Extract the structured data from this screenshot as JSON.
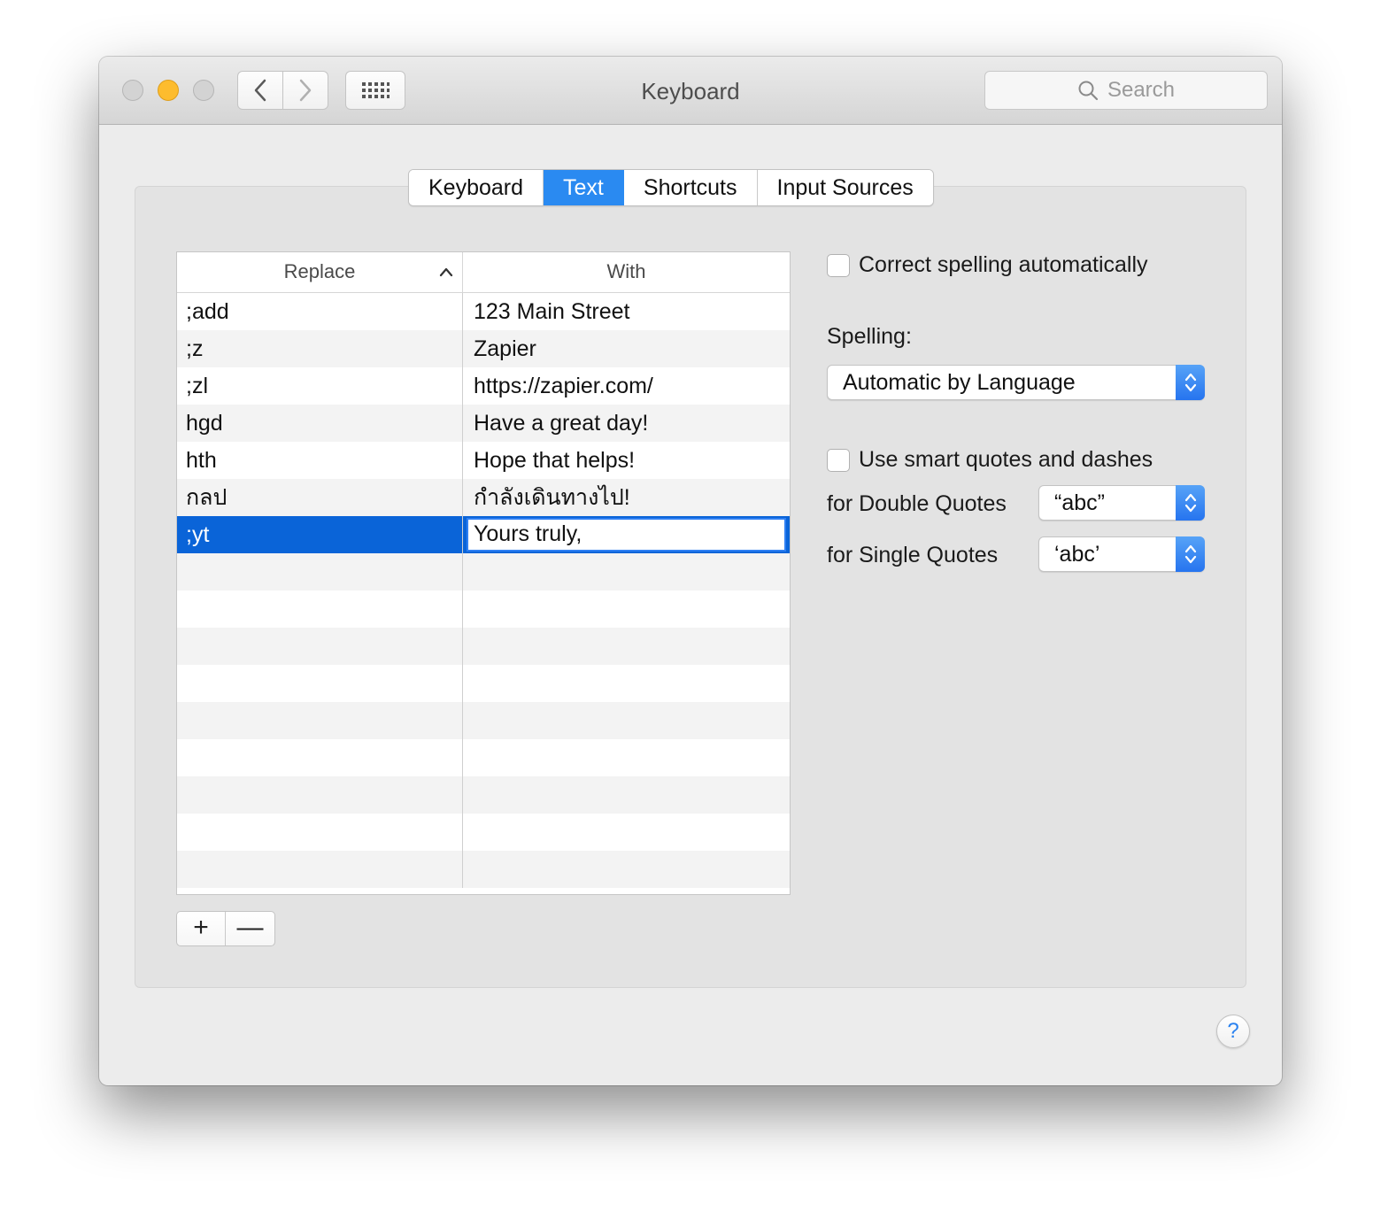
{
  "window": {
    "title": "Keyboard"
  },
  "toolbar": {
    "back_icon": "chevron-left-icon",
    "forward_icon": "chevron-right-icon",
    "grid_icon": "show-all-grid-icon",
    "search_placeholder": "Search"
  },
  "tabs": [
    {
      "label": "Keyboard",
      "active": false
    },
    {
      "label": "Text",
      "active": true
    },
    {
      "label": "Shortcuts",
      "active": false
    },
    {
      "label": "Input Sources",
      "active": false
    }
  ],
  "table": {
    "columns": {
      "replace": "Replace",
      "with": "With",
      "sort": "ascending"
    },
    "rows": [
      {
        "replace": ";add",
        "with": "123 Main Street"
      },
      {
        "replace": ";z",
        "with": "Zapier"
      },
      {
        "replace": ";zl",
        "with": "https://zapier.com/"
      },
      {
        "replace": "hgd",
        "with": "Have a great day!"
      },
      {
        "replace": "hth",
        "with": "Hope that helps!"
      },
      {
        "replace": "กลป",
        "with": "กำลังเดินทางไป!"
      },
      {
        "replace": ";yt",
        "with": "Yours truly,",
        "selected": true,
        "editing": true
      }
    ],
    "add_label": "+",
    "remove_label": "—"
  },
  "options": {
    "correct_spelling": {
      "label": "Correct spelling automatically",
      "checked": false
    },
    "spelling_label": "Spelling:",
    "spelling_value": "Automatic by Language",
    "smart_quotes": {
      "label": "Use smart quotes and dashes",
      "checked": false
    },
    "double_quotes_label": "for Double Quotes",
    "double_quotes_value": "“abc”",
    "single_quotes_label": "for Single Quotes",
    "single_quotes_value": "‘abc’"
  },
  "help_label": "?",
  "colors": {
    "accent": "#2a8af1",
    "selection": "#0a64d8",
    "minimize": "#fdbc2e"
  }
}
